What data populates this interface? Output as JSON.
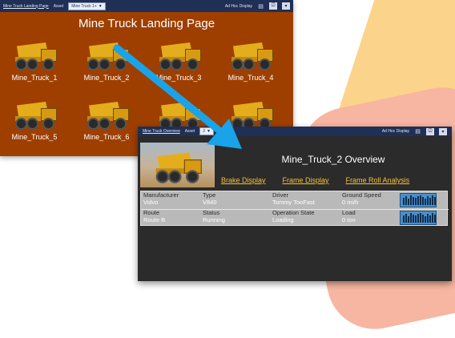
{
  "landing": {
    "overview_link": "Mine Truck Landing Page",
    "asset_label": "Asset",
    "asset_value": "Mine Truck 1+",
    "ad_hoc": "Ad Hoc Display",
    "title": "Mine Truck Landing Page",
    "trucks": [
      "Mine_Truck_1",
      "Mine_Truck_2",
      "Mine_Truck_3",
      "Mine_Truck_4",
      "Mine_Truck_5",
      "Mine_Truck_6",
      "",
      ""
    ]
  },
  "overview": {
    "overview_link": "Mine Truck Overview",
    "asset_label": "Asset",
    "asset_value": "2",
    "ad_hoc": "Ad Hoc Display",
    "title": "Mine_Truck_2 Overview",
    "links": [
      "Brake Display",
      "Frame Display",
      "Frame Roll Analysis"
    ],
    "row1": {
      "manufacturer_k": "Manufacturer",
      "manufacturer_v": "Volvo",
      "type_k": "Type",
      "type_v": "V840",
      "driver_k": "Driver",
      "driver_v": "Tommy TooFast",
      "speed_k": "Ground Speed",
      "speed_v": "0  mi/h"
    },
    "row2": {
      "route_k": "Route",
      "route_v": "Route B",
      "status_k": "Status",
      "status_v": "Running",
      "state_k": "Operation State",
      "state_v": "Loading",
      "load_k": "Load",
      "load_v": "0  ton"
    }
  },
  "colors": {
    "accent_arrow": "#1aa3e8",
    "link": "#f3c23b",
    "landing_bg": "#9e3f00"
  },
  "icons": [
    "dropdown-icon",
    "monitor-icon",
    "save-icon",
    "arrow-icon",
    "truck-icon"
  ]
}
